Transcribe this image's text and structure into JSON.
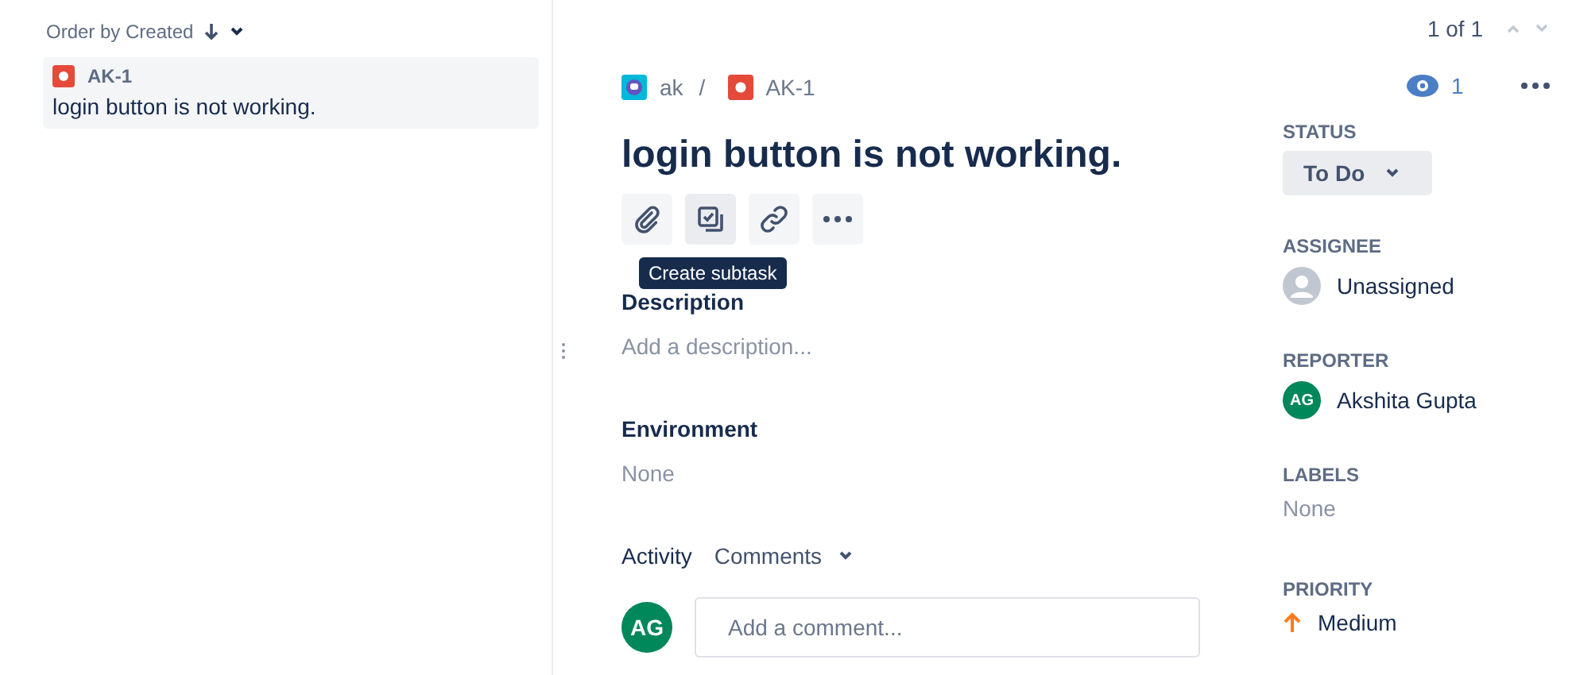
{
  "list": {
    "sort_label": "Order by Created",
    "items": [
      {
        "key": "AK-1",
        "summary": "login button is not working."
      }
    ]
  },
  "pager": {
    "text": "1 of 1"
  },
  "breadcrumb": {
    "project": "ak",
    "separator": "/",
    "issue_key": "AK-1"
  },
  "watchers": {
    "count": "1"
  },
  "title": "login button is not working.",
  "actions": [
    {
      "kind": "attach"
    },
    {
      "kind": "subtask",
      "tooltip": "Create subtask"
    },
    {
      "kind": "link"
    },
    {
      "kind": "more"
    }
  ],
  "sections": [
    {
      "heading": "Description",
      "value": "Add a description..."
    },
    {
      "heading": "Environment",
      "value": "None"
    }
  ],
  "activity": {
    "label": "Activity",
    "filter": "Comments",
    "avatar": "AG",
    "comment_placeholder": "Add a comment..."
  },
  "fields": [
    {
      "kind": "status",
      "label": "STATUS",
      "value": "To Do"
    },
    {
      "kind": "user",
      "label": "ASSIGNEE",
      "value": "Unassigned"
    },
    {
      "kind": "user",
      "label": "REPORTER",
      "value": "Akshita Gupta",
      "avatar": "AG"
    },
    {
      "kind": "text",
      "label": "LABELS",
      "value": "None"
    },
    {
      "kind": "priority",
      "label": "PRIORITY",
      "value": "Medium"
    }
  ]
}
